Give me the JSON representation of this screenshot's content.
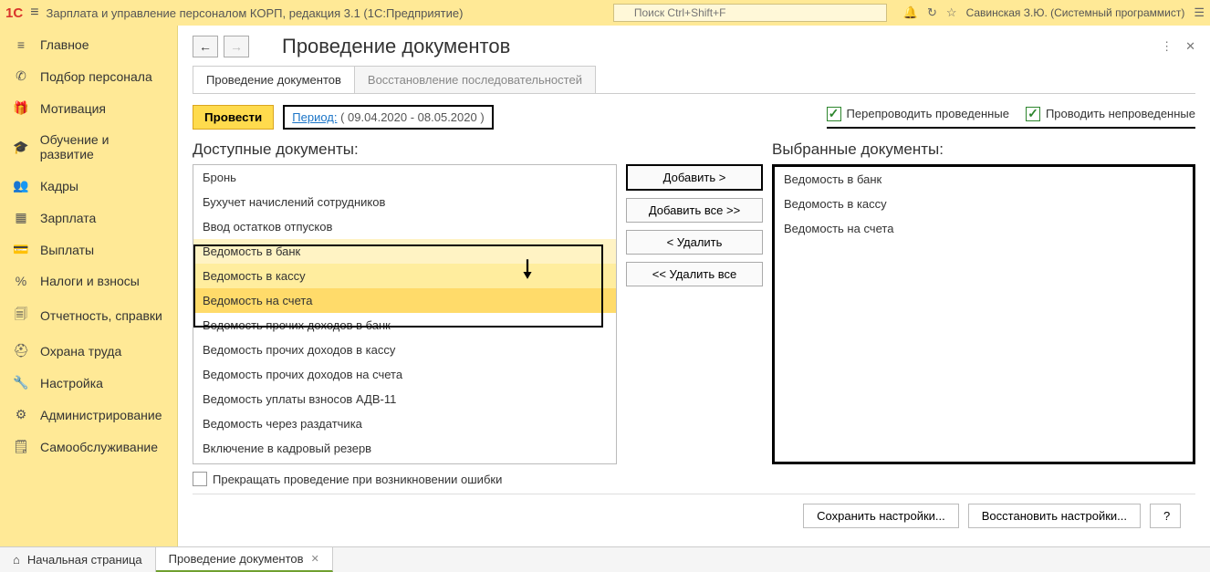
{
  "header": {
    "app_title": "Зарплата и управление персоналом КОРП, редакция 3.1  (1С:Предприятие)",
    "search_placeholder": "Поиск Ctrl+Shift+F",
    "user": "Савинская З.Ю. (Системный программист)"
  },
  "sidebar": [
    {
      "icon": "≡",
      "label": "Главное"
    },
    {
      "icon": "✆",
      "label": "Подбор персонала"
    },
    {
      "icon": "🎁",
      "label": "Мотивация"
    },
    {
      "icon": "🎓",
      "label": "Обучение и развитие"
    },
    {
      "icon": "👥",
      "label": "Кадры"
    },
    {
      "icon": "▦",
      "label": "Зарплата"
    },
    {
      "icon": "💳",
      "label": "Выплаты"
    },
    {
      "icon": "%",
      "label": "Налоги и взносы"
    },
    {
      "icon": "🗐",
      "label": "Отчетность, справки"
    },
    {
      "icon": "⛑",
      "label": "Охрана труда"
    },
    {
      "icon": "🔧",
      "label": "Настройка"
    },
    {
      "icon": "⚙",
      "label": "Администрирование"
    },
    {
      "icon": "🗒",
      "label": "Самообслуживание"
    }
  ],
  "page": {
    "title": "Проведение документов",
    "tabs": [
      "Проведение документов",
      "Восстановление последовательностей"
    ],
    "active_tab": 0,
    "execute_btn": "Провести",
    "period_label": "Период:",
    "period_value": "( 09.04.2020 - 08.05.2020 )",
    "chk1": "Перепроводить проведенные",
    "chk2": "Проводить непроведенные",
    "available_title": "Доступные документы:",
    "selected_title": "Выбранные документы:",
    "available": [
      "Бронь",
      "Бухучет начислений сотрудников",
      "Ввод остатков отпусков",
      "Ведомость в банк",
      "Ведомость в кассу",
      "Ведомость на счета",
      "Ведомость прочих доходов в банк",
      "Ведомость прочих доходов в кассу",
      "Ведомость прочих доходов на счета",
      "Ведомость уплаты взносов АДВ-11",
      "Ведомость через раздатчика",
      "Включение в кадровый резерв"
    ],
    "hl_start": 3,
    "hl_end": 5,
    "selected": [
      "Ведомость в банк",
      "Ведомость в кассу",
      "Ведомость на счета"
    ],
    "btn_add": "Добавить >",
    "btn_add_all": "Добавить все >>",
    "btn_del": "< Удалить",
    "btn_del_all": "<< Удалить все",
    "stop_on_error": "Прекращать проведение при возникновении ошибки",
    "save_btn": "Сохранить настройки...",
    "restore_btn": "Восстановить настройки...",
    "help_btn": "?"
  },
  "bottom_tabs": {
    "home": "Начальная страница",
    "current": "Проведение документов"
  }
}
